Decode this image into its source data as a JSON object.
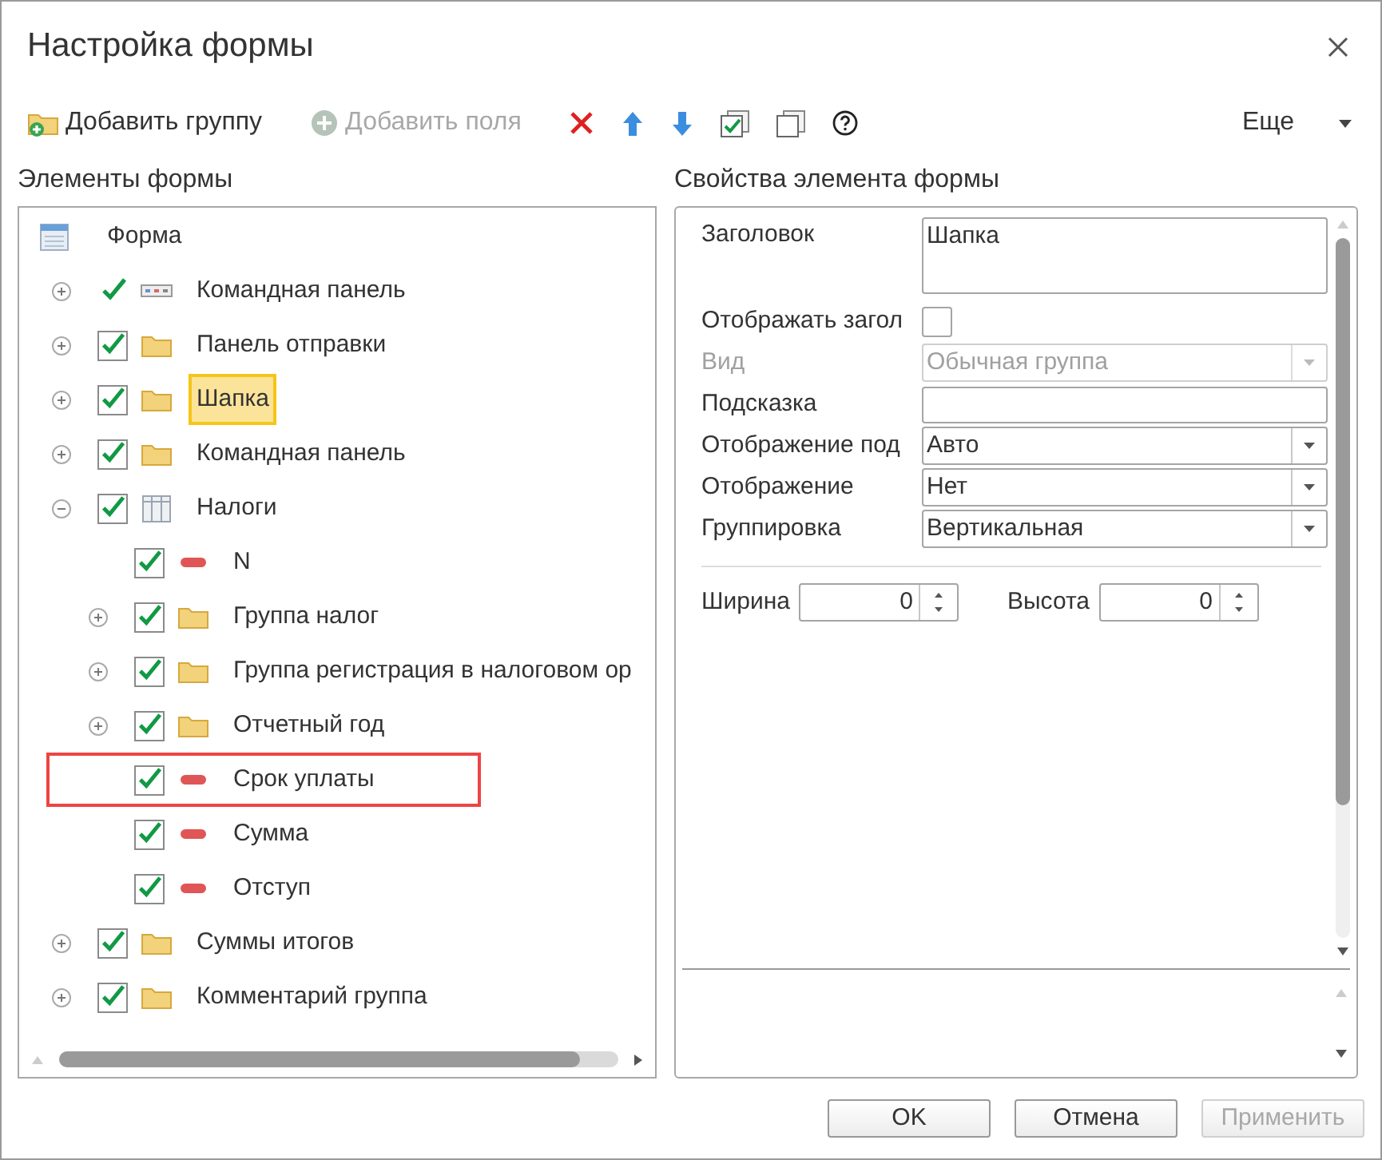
{
  "window": {
    "title": "Настройка формы"
  },
  "toolbar": [
    {
      "kind": "add-group",
      "label": "Добавить группу",
      "disabled": false
    },
    {
      "kind": "add-fields",
      "label": "Добавить поля",
      "disabled": true
    },
    {
      "kind": "delete"
    },
    {
      "kind": "up"
    },
    {
      "kind": "down"
    },
    {
      "kind": "check-all"
    },
    {
      "kind": "copy"
    },
    {
      "kind": "help"
    }
  ],
  "more_menu": {
    "label": "Еще"
  },
  "left_panel": {
    "title": "Элементы формы",
    "tree": [
      {
        "kind": "form",
        "label": "Форма",
        "selected": false,
        "highlighted": false,
        "children": [
          {
            "kind": "command-bar",
            "label": "Командная панель",
            "boxed": false,
            "checked": true,
            "selected": false,
            "highlighted": false,
            "expandable": true,
            "expanded": false
          },
          {
            "kind": "folder",
            "label": "Панель отправки",
            "boxed": true,
            "checked": true,
            "selected": false,
            "highlighted": false,
            "expandable": true,
            "expanded": false
          },
          {
            "kind": "folder",
            "label": "Шапка",
            "boxed": true,
            "checked": true,
            "selected": true,
            "highlighted": false,
            "expandable": true,
            "expanded": false
          },
          {
            "kind": "folder",
            "label": "Командная панель",
            "boxed": true,
            "checked": true,
            "selected": false,
            "highlighted": false,
            "expandable": true,
            "expanded": false
          },
          {
            "kind": "table",
            "label": "Налоги",
            "boxed": true,
            "checked": true,
            "selected": false,
            "highlighted": false,
            "expandable": true,
            "expanded": true,
            "children": [
              {
                "kind": "field",
                "label": "N",
                "boxed": true,
                "checked": true,
                "selected": false,
                "highlighted": false,
                "expandable": false
              },
              {
                "kind": "folder",
                "label": "Группа налог",
                "boxed": true,
                "checked": true,
                "selected": false,
                "highlighted": false,
                "expandable": true,
                "expanded": false
              },
              {
                "kind": "folder",
                "label": "Группа регистрация в налоговом ор",
                "boxed": true,
                "checked": true,
                "selected": false,
                "highlighted": false,
                "expandable": true,
                "expanded": false
              },
              {
                "kind": "folder",
                "label": "Отчетный год",
                "boxed": true,
                "checked": true,
                "selected": false,
                "highlighted": false,
                "expandable": true,
                "expanded": false
              },
              {
                "kind": "field",
                "label": "Срок уплаты",
                "boxed": true,
                "checked": true,
                "selected": false,
                "highlighted": true,
                "expandable": false
              },
              {
                "kind": "field",
                "label": "Сумма",
                "boxed": true,
                "checked": true,
                "selected": false,
                "highlighted": false,
                "expandable": false
              },
              {
                "kind": "field",
                "label": "Отступ",
                "boxed": true,
                "checked": true,
                "selected": false,
                "highlighted": false,
                "expandable": false
              }
            ]
          },
          {
            "kind": "folder",
            "label": "Суммы итогов",
            "boxed": true,
            "checked": true,
            "selected": false,
            "highlighted": false,
            "expandable": true,
            "expanded": false
          },
          {
            "kind": "folder",
            "label": "Комментарий группа",
            "boxed": true,
            "checked": true,
            "selected": false,
            "highlighted": false,
            "expandable": true,
            "expanded": false
          }
        ]
      }
    ]
  },
  "right_panel": {
    "title": "Свойства элемента формы",
    "properties": [
      {
        "kind": "textarea",
        "label": "Заголовок",
        "value": "Шапка",
        "disabled": false
      },
      {
        "kind": "checkbox",
        "label": "Отображать загол",
        "checked": false,
        "disabled": false
      },
      {
        "kind": "select",
        "label": "Вид",
        "value": "Обычная группа",
        "disabled": true
      },
      {
        "kind": "text",
        "label": "Подсказка",
        "disabled": false
      },
      {
        "kind": "select",
        "label": "Отображение под",
        "value": "Авто",
        "disabled": false
      },
      {
        "kind": "select",
        "label": "Отображение",
        "value": "Нет",
        "disabled": false
      },
      {
        "kind": "select",
        "label": "Группировка",
        "value": "Вертикальная",
        "disabled": false
      }
    ],
    "size_fields": [
      {
        "label": "Ширина",
        "value": "0"
      },
      {
        "label": "Высота",
        "value": "0"
      }
    ]
  },
  "buttons": [
    {
      "label": "OK",
      "disabled": false
    },
    {
      "label": "Отмена",
      "disabled": false
    },
    {
      "label": "Применить",
      "disabled": true
    }
  ]
}
